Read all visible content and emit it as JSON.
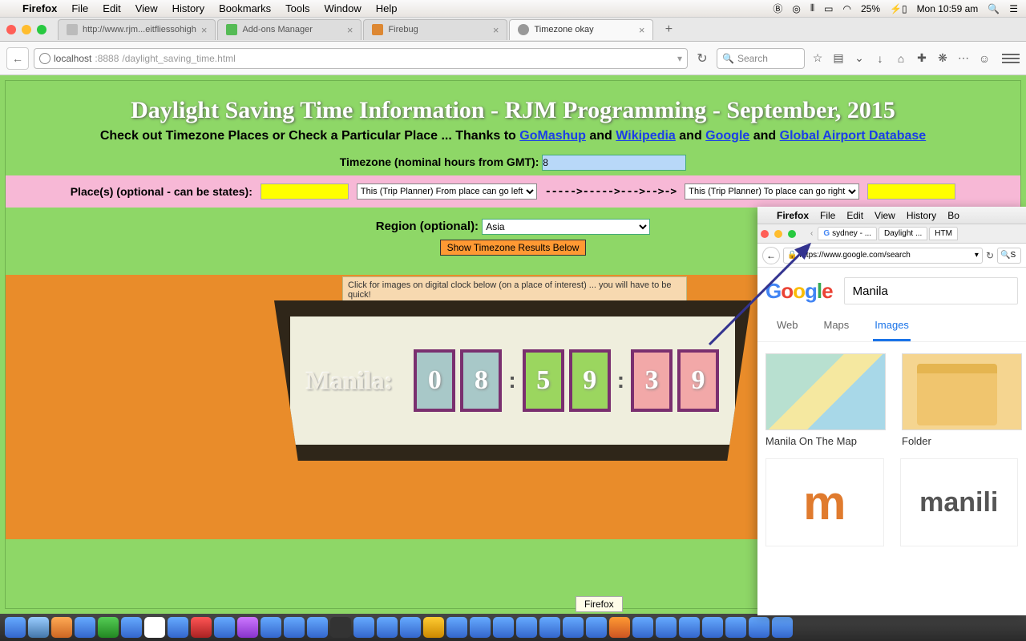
{
  "menubar": {
    "app": "Firefox",
    "items": [
      "File",
      "Edit",
      "View",
      "History",
      "Bookmarks",
      "Tools",
      "Window",
      "Help"
    ],
    "battery": "25%",
    "clock": "Mon 10:59 am"
  },
  "tabs": [
    {
      "title": "http://www.rjm...eitfliessohigh"
    },
    {
      "title": "Add-ons Manager"
    },
    {
      "title": "Firebug"
    },
    {
      "title": "Timezone okay",
      "active": true
    }
  ],
  "url": {
    "host": "localhost",
    "port": ":8888",
    "path": "/daylight_saving_time.html"
  },
  "searchbar_placeholder": "Search",
  "page": {
    "h1": "Daylight Saving Time Information - RJM Programming - September, 2015",
    "sub_pre": "Check out Timezone Places or Check a Particular Place ... Thanks to ",
    "links": {
      "gomashup": "GoMashup",
      "wikipedia": "Wikipedia",
      "google": "Google",
      "gadb": "Global Airport Database"
    },
    "and": " and ",
    "tz_label": "Timezone (nominal hours from GMT): ",
    "tz_value": "8",
    "place_label": "Place(s) (optional - can be states): ",
    "from_sel": "This (Trip Planner) From place can go left",
    "arrows": "----->----->--->-->->",
    "to_sel": "This (Trip Planner) To place can go right",
    "region_label": "Region (optional): ",
    "region_value": "Asia",
    "show_btn": "Show Timezone Results Below",
    "hint": "Click for images on digital clock below (on a place of interest) ... you will have to be quick!",
    "city": "Manila:",
    "digits": [
      "0",
      "8",
      "5",
      "9",
      "3",
      "9"
    ],
    "colon": ":"
  },
  "win2": {
    "menubar": {
      "app": "Firefox",
      "items": [
        "File",
        "Edit",
        "View",
        "History",
        "Bo"
      ]
    },
    "tabs": [
      {
        "t": "sydney - ..."
      },
      {
        "t": "Daylight ..."
      },
      {
        "t": "HTM"
      }
    ],
    "url": "https://www.google.com/search",
    "search_hint": "S",
    "query": "Manila",
    "gtabs": {
      "web": "Web",
      "maps": "Maps",
      "images": "Images"
    },
    "r1": "Manila On The Map",
    "r2": "Folder",
    "logo2_text": "m",
    "brand": "manili"
  },
  "tooltip": "Firefox"
}
